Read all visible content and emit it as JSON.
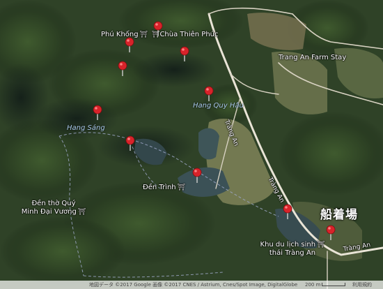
{
  "map": {
    "labels": {
      "phu_khong": "Phú Khống",
      "chua_thien_phuc": "Chùa Thiên Phúc",
      "trang_an_farm_stay": "Trang An Farm Stay",
      "hang_quy_hau": "Hang Quy Hậu",
      "hang_sang": "Hang Sáng",
      "den_trinh": "Đền Trình",
      "den_tho_quy_line1": "Đền thờ Quý",
      "den_tho_quy_line2": "Minh Đại Vương",
      "khu_du_lich_line1": "Khu du lịch sinh",
      "khu_du_lich_line2": "thái Tràng An",
      "boat_dock": "船着場",
      "road_trang_an_1": "Tràng An",
      "road_trang_an_2": "Tràng An",
      "road_trang_an_3": "Tràng An"
    },
    "markers_count": 10,
    "colors": {
      "marker": "#d8232a",
      "water_label": "#a9c8ea",
      "road": "#e9e4d6"
    },
    "icons": [
      "map-pin-icon",
      "temple-icon",
      "hotel-icon",
      "attraction-icon"
    ]
  },
  "footer": {
    "attribution": "地図データ ©2017 Google 画像 ©2017 CNES / Astrium, Cnes/Spot Image, DigitalGlobe",
    "scale_label": "200 m",
    "terms": "利用規約"
  }
}
